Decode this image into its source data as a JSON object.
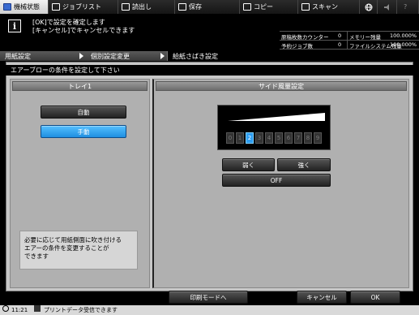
{
  "top_tabs": [
    {
      "label": "機械状態",
      "icon": "machine-status-icon",
      "active": true
    },
    {
      "label": "ジョブリスト",
      "icon": "job-list-icon",
      "active": false
    },
    {
      "label": "読出し",
      "icon": "read-icon",
      "active": false
    },
    {
      "label": "保存",
      "icon": "save-icon",
      "active": false
    },
    {
      "label": "コピー",
      "icon": "copy-icon",
      "active": false
    },
    {
      "label": "スキャン",
      "icon": "scan-icon",
      "active": false
    }
  ],
  "top_icons": [
    "globe-icon",
    "volume-icon",
    "help-icon"
  ],
  "message": {
    "line1": "[OK]で設定を確定します",
    "line2": "[キャンセル]でキャンセルできます"
  },
  "status": {
    "row1": {
      "label1": "原稿枚数カウンター",
      "value1": "0",
      "label2": "メモリー残量",
      "value2": "100.000%"
    },
    "row2": {
      "label1": "予約ジョブ数",
      "value1": "0",
      "label2": "ファイルシステム残量",
      "value2": "100.000%"
    }
  },
  "breadcrumb": {
    "item1": "用紙設定",
    "item2": "個別設定変更",
    "item3": "給紙さばき設定"
  },
  "instruction": "エアーブローの条件を設定して下さい",
  "left_panel": {
    "header": "トレイ1",
    "auto_label": "自動",
    "manual_label": "手動",
    "selected": "手動",
    "note_line1": "必要に応じて用紙側面に吹き付ける",
    "note_line2": "エアーの条件を変更することが",
    "note_line3": "できます"
  },
  "right_panel": {
    "header": "サイド風量設定",
    "levels": [
      "0",
      "1",
      "2",
      "3",
      "4",
      "5",
      "6",
      "7",
      "8",
      "9"
    ],
    "current_level": 2,
    "weak_label": "弱く",
    "strong_label": "強く",
    "off_label": "OFF"
  },
  "bottom": {
    "print_mode_label": "印刷モードへ",
    "cancel_label": "キャンセル",
    "ok_label": "OK"
  },
  "statusbar": {
    "time": "11:21",
    "message": "プリントデータ受信できます"
  },
  "colors": {
    "selected_button": "#2e9df0",
    "panel_bg": "#b0b0b0",
    "main_bg": "#c7c7c7"
  }
}
